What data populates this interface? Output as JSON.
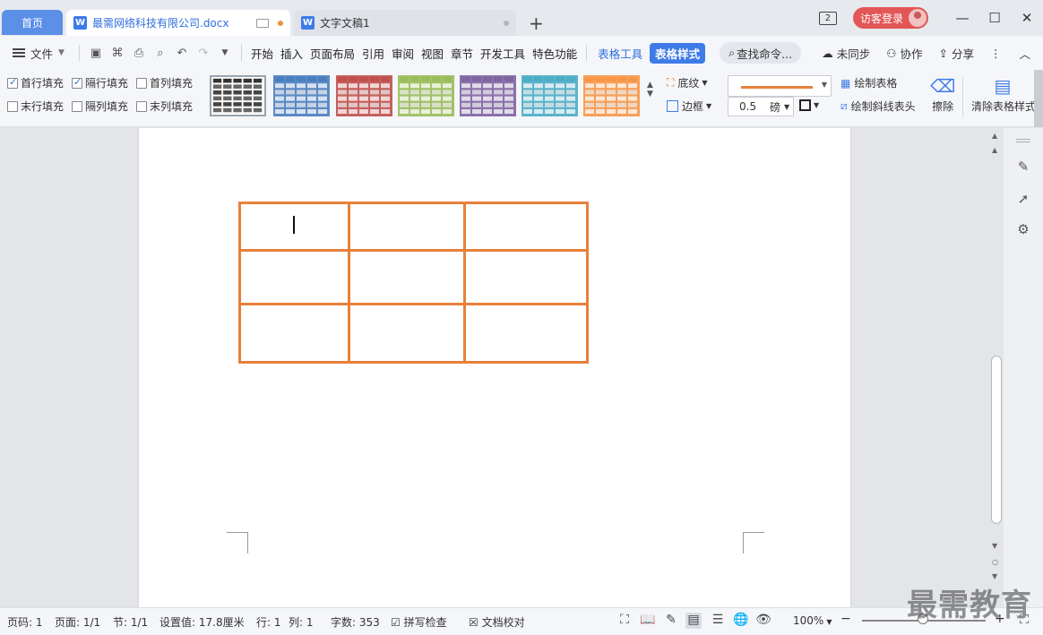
{
  "tabs": {
    "home": "首页",
    "active_doc": "最需网络科技有限公司.docx",
    "second_doc": "文字文稿1",
    "new_tab": "+"
  },
  "window": {
    "badge": "2",
    "login": "访客登录",
    "minimize": "—",
    "maximize": "☐",
    "close": "✕"
  },
  "menubar": {
    "file": "文件",
    "items": [
      "开始",
      "插入",
      "页面布局",
      "引用",
      "审阅",
      "视图",
      "章节",
      "开发工具",
      "特色功能"
    ],
    "table_tools": "表格工具",
    "table_style": "表格样式",
    "search": "查找命令...",
    "sync": "未同步",
    "collab": "协作",
    "share": "分享"
  },
  "ribbon": {
    "fill_options": [
      {
        "label": "首行填充",
        "checked": true
      },
      {
        "label": "隔行填充",
        "checked": true
      },
      {
        "label": "首列填充",
        "checked": false
      },
      {
        "label": "末行填充",
        "checked": false
      },
      {
        "label": "隔列填充",
        "checked": false
      },
      {
        "label": "末列填充",
        "checked": false
      }
    ],
    "style_colors": [
      "#333333",
      "#4a7ebf",
      "#c0504d",
      "#9bbb59",
      "#8064a2",
      "#4bacc6",
      "#f79646"
    ],
    "shading": "底纹",
    "border": "边框",
    "line_color": "#e8803a",
    "line_weight": "0.5",
    "line_unit": "磅",
    "draw_table": "绘制表格",
    "draw_diagonal": "绘制斜线表头",
    "erase": "擦除",
    "clear_style": "清除表格样式"
  },
  "document": {
    "table_border_color": "#e8803a",
    "rows": 3,
    "cols": 3
  },
  "status": {
    "page_code": "页码: 1",
    "page": "页面: 1/1",
    "section": "节: 1/1",
    "setting": "设置值: 17.8厘米",
    "row": "行: 1",
    "col": "列: 1",
    "word_count": "字数: 353",
    "spell_check": "拼写检查",
    "doc_proof": "文档校对",
    "zoom": "100%"
  },
  "watermark": "最需教育"
}
